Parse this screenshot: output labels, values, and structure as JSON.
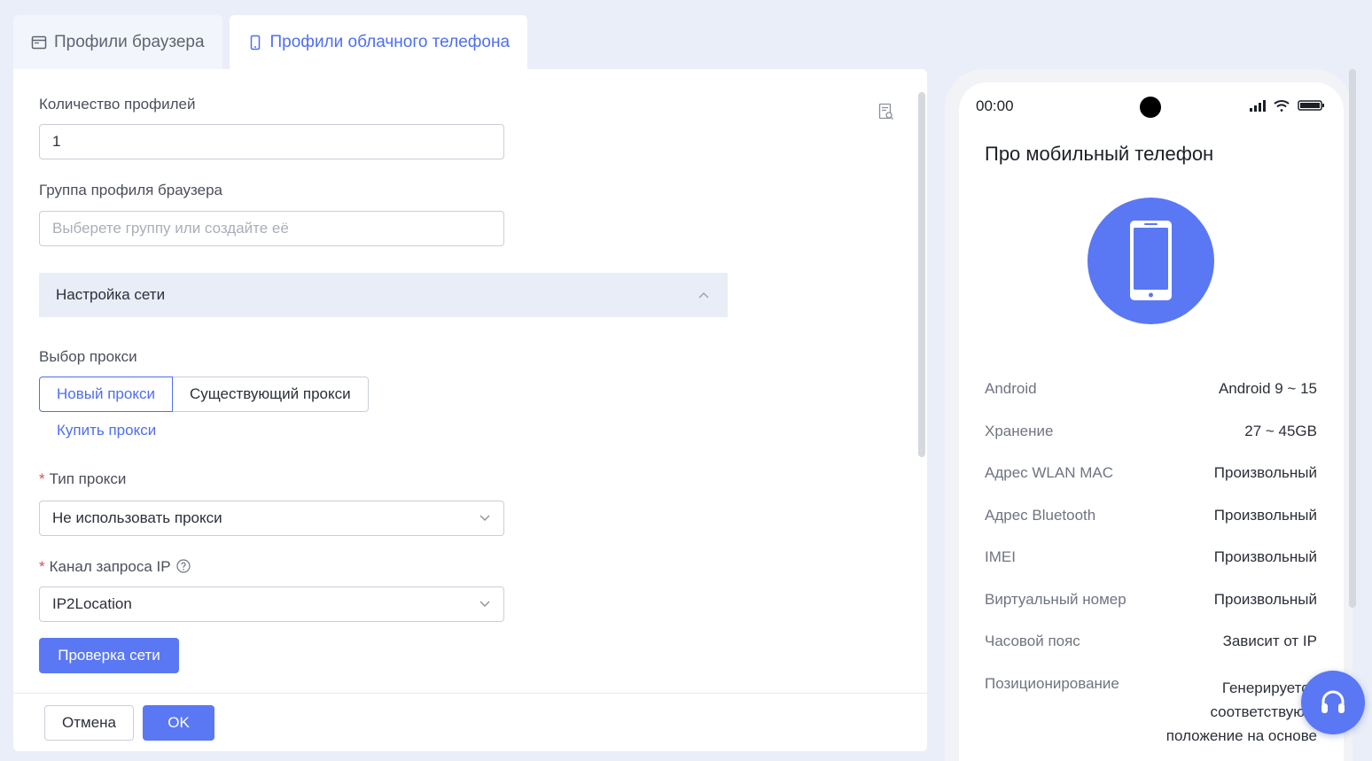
{
  "tabs": [
    {
      "label": "Профили браузера",
      "icon": "browser-window-icon",
      "active": false
    },
    {
      "label": "Профили облачного телефона",
      "icon": "mobile-phone-icon",
      "active": true
    }
  ],
  "form": {
    "count_label": "Количество профилей",
    "count_value": "1",
    "group_label": "Группа профиля браузера",
    "group_placeholder": "Выберете группу или создайте её",
    "network_section": "Настройка сети",
    "proxy_choice_label": "Выбор прокси",
    "proxy_new": "Новый прокси",
    "proxy_existing": "Существующий прокси",
    "buy_proxy": "Купить прокси",
    "proxy_type_label": "Тип прокси",
    "proxy_type_value": "Не использовать прокси",
    "ip_channel_label": "Канал запроса IP",
    "ip_channel_value": "IP2Location",
    "check_network": "Проверка сети"
  },
  "footer": {
    "cancel": "Отмена",
    "ok": "OK"
  },
  "phone": {
    "time": "00:00",
    "title": "Про мобильный телефон",
    "specs": [
      {
        "key": "Android",
        "value": "Android 9 ~ 15"
      },
      {
        "key": "Хранение",
        "value": "27 ~ 45GB"
      },
      {
        "key": "Адрес WLAN MAC",
        "value": "Произвольный"
      },
      {
        "key": "Адрес Bluetooth",
        "value": "Произвольный"
      },
      {
        "key": "IMEI",
        "value": "Произвольный"
      },
      {
        "key": "Виртуальный номер",
        "value": "Произвольный"
      },
      {
        "key": "Часовой пояс",
        "value": "Зависит от IP"
      },
      {
        "key": "Позиционирование",
        "value": ""
      }
    ],
    "positioning_lines": [
      "Генерируется",
      "соответствующ",
      "положение на основе"
    ]
  },
  "colors": {
    "accent": "#4e6ef2",
    "primary_button": "#5a78f4",
    "required": "#e5484d",
    "page_bg": "#e9eef8"
  }
}
